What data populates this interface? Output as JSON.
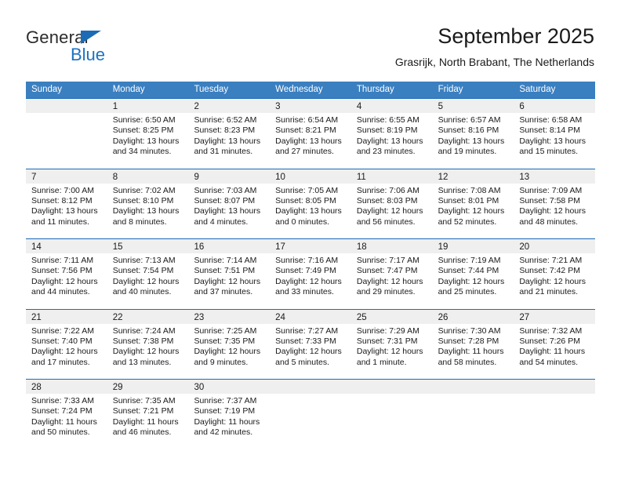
{
  "brand": {
    "name_top": "General",
    "name_bottom": "Blue",
    "accent_color": "#1b72c0",
    "triangle_color": "#1b6cb5"
  },
  "header": {
    "title": "September 2025",
    "location": "Grasrijk, North Brabant, The Netherlands"
  },
  "calendar": {
    "header_bg": "#3a7fc0",
    "row_divider_color": "#1b6cb5",
    "day_band_bg": "#efefef",
    "weekdays": [
      "Sunday",
      "Monday",
      "Tuesday",
      "Wednesday",
      "Thursday",
      "Friday",
      "Saturday"
    ],
    "weeks": [
      [
        {
          "day": "",
          "lines": []
        },
        {
          "day": "1",
          "lines": [
            "Sunrise: 6:50 AM",
            "Sunset: 8:25 PM",
            "Daylight: 13 hours and 34 minutes."
          ]
        },
        {
          "day": "2",
          "lines": [
            "Sunrise: 6:52 AM",
            "Sunset: 8:23 PM",
            "Daylight: 13 hours and 31 minutes."
          ]
        },
        {
          "day": "3",
          "lines": [
            "Sunrise: 6:54 AM",
            "Sunset: 8:21 PM",
            "Daylight: 13 hours and 27 minutes."
          ]
        },
        {
          "day": "4",
          "lines": [
            "Sunrise: 6:55 AM",
            "Sunset: 8:19 PM",
            "Daylight: 13 hours and 23 minutes."
          ]
        },
        {
          "day": "5",
          "lines": [
            "Sunrise: 6:57 AM",
            "Sunset: 8:16 PM",
            "Daylight: 13 hours and 19 minutes."
          ]
        },
        {
          "day": "6",
          "lines": [
            "Sunrise: 6:58 AM",
            "Sunset: 8:14 PM",
            "Daylight: 13 hours and 15 minutes."
          ]
        }
      ],
      [
        {
          "day": "7",
          "lines": [
            "Sunrise: 7:00 AM",
            "Sunset: 8:12 PM",
            "Daylight: 13 hours and 11 minutes."
          ]
        },
        {
          "day": "8",
          "lines": [
            "Sunrise: 7:02 AM",
            "Sunset: 8:10 PM",
            "Daylight: 13 hours and 8 minutes."
          ]
        },
        {
          "day": "9",
          "lines": [
            "Sunrise: 7:03 AM",
            "Sunset: 8:07 PM",
            "Daylight: 13 hours and 4 minutes."
          ]
        },
        {
          "day": "10",
          "lines": [
            "Sunrise: 7:05 AM",
            "Sunset: 8:05 PM",
            "Daylight: 13 hours and 0 minutes."
          ]
        },
        {
          "day": "11",
          "lines": [
            "Sunrise: 7:06 AM",
            "Sunset: 8:03 PM",
            "Daylight: 12 hours and 56 minutes."
          ]
        },
        {
          "day": "12",
          "lines": [
            "Sunrise: 7:08 AM",
            "Sunset: 8:01 PM",
            "Daylight: 12 hours and 52 minutes."
          ]
        },
        {
          "day": "13",
          "lines": [
            "Sunrise: 7:09 AM",
            "Sunset: 7:58 PM",
            "Daylight: 12 hours and 48 minutes."
          ]
        }
      ],
      [
        {
          "day": "14",
          "lines": [
            "Sunrise: 7:11 AM",
            "Sunset: 7:56 PM",
            "Daylight: 12 hours and 44 minutes."
          ]
        },
        {
          "day": "15",
          "lines": [
            "Sunrise: 7:13 AM",
            "Sunset: 7:54 PM",
            "Daylight: 12 hours and 40 minutes."
          ]
        },
        {
          "day": "16",
          "lines": [
            "Sunrise: 7:14 AM",
            "Sunset: 7:51 PM",
            "Daylight: 12 hours and 37 minutes."
          ]
        },
        {
          "day": "17",
          "lines": [
            "Sunrise: 7:16 AM",
            "Sunset: 7:49 PM",
            "Daylight: 12 hours and 33 minutes."
          ]
        },
        {
          "day": "18",
          "lines": [
            "Sunrise: 7:17 AM",
            "Sunset: 7:47 PM",
            "Daylight: 12 hours and 29 minutes."
          ]
        },
        {
          "day": "19",
          "lines": [
            "Sunrise: 7:19 AM",
            "Sunset: 7:44 PM",
            "Daylight: 12 hours and 25 minutes."
          ]
        },
        {
          "day": "20",
          "lines": [
            "Sunrise: 7:21 AM",
            "Sunset: 7:42 PM",
            "Daylight: 12 hours and 21 minutes."
          ]
        }
      ],
      [
        {
          "day": "21",
          "lines": [
            "Sunrise: 7:22 AM",
            "Sunset: 7:40 PM",
            "Daylight: 12 hours and 17 minutes."
          ]
        },
        {
          "day": "22",
          "lines": [
            "Sunrise: 7:24 AM",
            "Sunset: 7:38 PM",
            "Daylight: 12 hours and 13 minutes."
          ]
        },
        {
          "day": "23",
          "lines": [
            "Sunrise: 7:25 AM",
            "Sunset: 7:35 PM",
            "Daylight: 12 hours and 9 minutes."
          ]
        },
        {
          "day": "24",
          "lines": [
            "Sunrise: 7:27 AM",
            "Sunset: 7:33 PM",
            "Daylight: 12 hours and 5 minutes."
          ]
        },
        {
          "day": "25",
          "lines": [
            "Sunrise: 7:29 AM",
            "Sunset: 7:31 PM",
            "Daylight: 12 hours and 1 minute."
          ]
        },
        {
          "day": "26",
          "lines": [
            "Sunrise: 7:30 AM",
            "Sunset: 7:28 PM",
            "Daylight: 11 hours and 58 minutes."
          ]
        },
        {
          "day": "27",
          "lines": [
            "Sunrise: 7:32 AM",
            "Sunset: 7:26 PM",
            "Daylight: 11 hours and 54 minutes."
          ]
        }
      ],
      [
        {
          "day": "28",
          "lines": [
            "Sunrise: 7:33 AM",
            "Sunset: 7:24 PM",
            "Daylight: 11 hours and 50 minutes."
          ]
        },
        {
          "day": "29",
          "lines": [
            "Sunrise: 7:35 AM",
            "Sunset: 7:21 PM",
            "Daylight: 11 hours and 46 minutes."
          ]
        },
        {
          "day": "30",
          "lines": [
            "Sunrise: 7:37 AM",
            "Sunset: 7:19 PM",
            "Daylight: 11 hours and 42 minutes."
          ]
        },
        {
          "day": "",
          "lines": []
        },
        {
          "day": "",
          "lines": []
        },
        {
          "day": "",
          "lines": []
        },
        {
          "day": "",
          "lines": []
        }
      ]
    ]
  }
}
